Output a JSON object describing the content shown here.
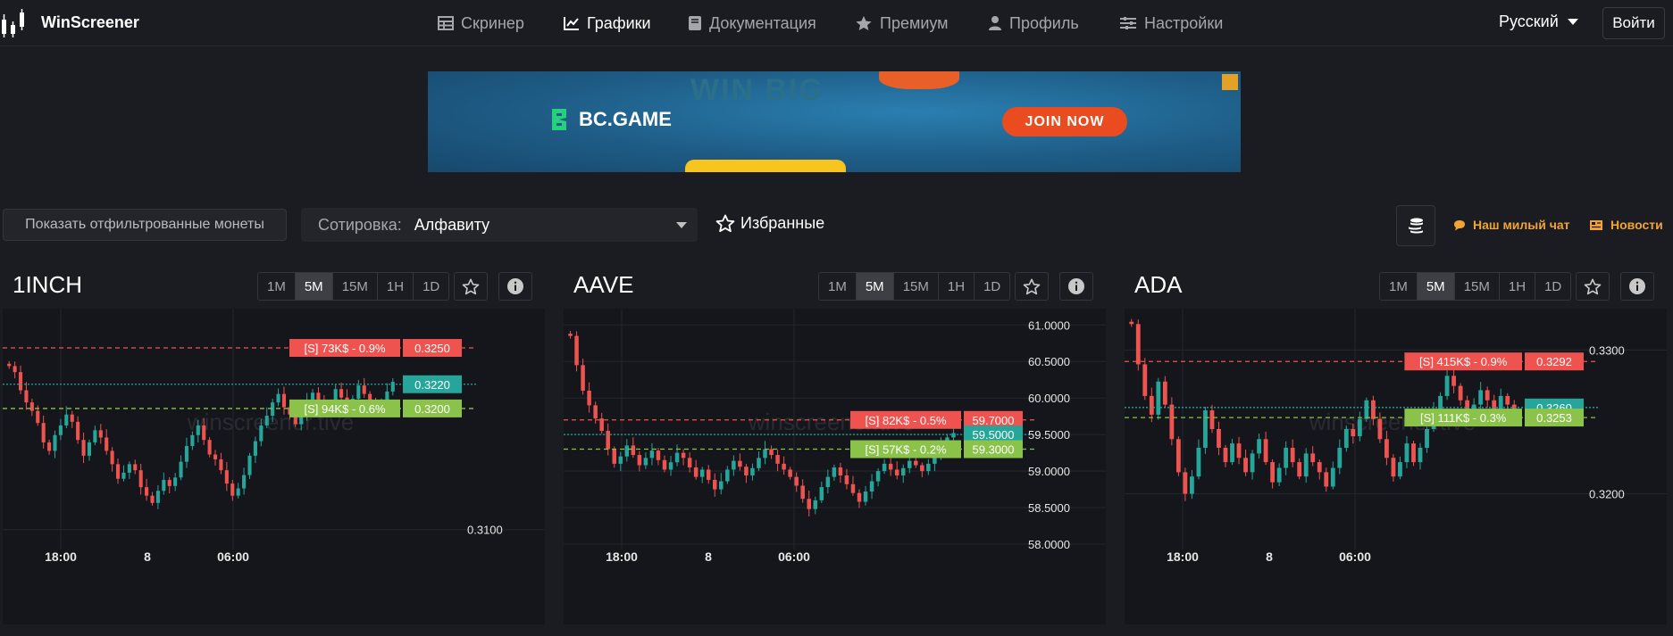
{
  "app": {
    "name": "WinScreener"
  },
  "nav": {
    "items": [
      {
        "label": "Скринер",
        "icon": "table-icon",
        "active": false
      },
      {
        "label": "Графики",
        "icon": "chart-line-icon",
        "active": true
      },
      {
        "label": "Документация",
        "icon": "book-icon",
        "active": false
      },
      {
        "label": "Премиум",
        "icon": "star-icon",
        "active": false
      },
      {
        "label": "Профиль",
        "icon": "user-icon",
        "active": false
      },
      {
        "label": "Настройки",
        "icon": "sliders-icon",
        "active": false
      }
    ],
    "language": "Русский",
    "login": "Войти"
  },
  "banner": {
    "brand": "BC.GAME",
    "cta": "JOIN NOW",
    "headline": "WIN BIG"
  },
  "controls": {
    "filter_button": "Показать отфильтрованные монеты",
    "sort_label": "Сотировка:",
    "sort_value": "Алфавиту",
    "favorites": "Избранные",
    "chat_link": "Наш милый чат",
    "news_link": "Новости"
  },
  "colors": {
    "bg": "#1b1c22",
    "chart_bg": "#15161b",
    "up": "#26a69a",
    "down": "#ef5350",
    "sell_level": "#ef5350",
    "buy_level": "#8bc34a",
    "current_price": "#26a69a",
    "accent": "#f1a433"
  },
  "timeframes": [
    "1M",
    "5M",
    "15M",
    "1H",
    "1D"
  ],
  "active_timeframe": "5M",
  "watermark": "winscreener.tive",
  "chart_data": [
    {
      "type": "candlestick",
      "symbol": "1INCH",
      "x_ticks": [
        "18:00",
        "8",
        "06:00"
      ],
      "y_ticks": [
        0.31
      ],
      "ylim": [
        0.3088,
        0.3278
      ],
      "levels": [
        {
          "kind": "sell",
          "label": "[S] 73K$ - 0.9%",
          "price": 0.325,
          "price_label": "0.3250"
        },
        {
          "kind": "current",
          "price": 0.322,
          "price_label": "0.3220"
        },
        {
          "kind": "buy",
          "label": "[S] 94K$ - 0.6%",
          "price": 0.32,
          "price_label": "0.3200"
        }
      ],
      "closes": [
        0.3235,
        0.323,
        0.3215,
        0.3205,
        0.3198,
        0.3188,
        0.3172,
        0.3165,
        0.3178,
        0.3186,
        0.3195,
        0.3189,
        0.3174,
        0.3161,
        0.3172,
        0.3182,
        0.3176,
        0.3165,
        0.3154,
        0.3142,
        0.3147,
        0.3154,
        0.3149,
        0.3135,
        0.3128,
        0.3122,
        0.3132,
        0.3141,
        0.3136,
        0.3143,
        0.3156,
        0.3169,
        0.3178,
        0.3186,
        0.3174,
        0.3162,
        0.3158,
        0.3149,
        0.3138,
        0.3128,
        0.3134,
        0.3145,
        0.3161,
        0.3173,
        0.3186,
        0.3194,
        0.3205,
        0.3212,
        0.3201,
        0.3195,
        0.3187,
        0.3193,
        0.3206,
        0.3213,
        0.3205,
        0.3198,
        0.3204,
        0.3216,
        0.3209,
        0.3202,
        0.3208,
        0.3219,
        0.3212,
        0.3205,
        0.3197,
        0.3203,
        0.3214,
        0.3222
      ]
    },
    {
      "type": "candlestick",
      "symbol": "AAVE",
      "x_ticks": [
        "18:00",
        "8",
        "06:00"
      ],
      "y_ticks": [
        61,
        60.5,
        60,
        59.5,
        59,
        58.5,
        58
      ],
      "y_tick_labels": [
        "61.0000",
        "60.5000",
        "60.0000",
        "59.5000",
        "59.0000",
        "58.5000",
        "58.0000"
      ],
      "ylim": [
        58,
        61.15
      ],
      "levels": [
        {
          "kind": "sell",
          "label": "[S] 82K$ - 0.5%",
          "price": 59.7,
          "price_label": "59.7000"
        },
        {
          "kind": "current",
          "price": 59.5,
          "price_label": "59.5000"
        },
        {
          "kind": "buy",
          "label": "[S] 57K$ - 0.2%",
          "price": 59.3,
          "price_label": "59.3000"
        }
      ],
      "closes": [
        60.85,
        60.45,
        60.1,
        59.9,
        59.72,
        59.55,
        59.3,
        59.1,
        59.2,
        59.35,
        59.22,
        59.08,
        59.18,
        59.28,
        59.15,
        59.02,
        59.12,
        59.25,
        59.18,
        59.05,
        58.92,
        59.02,
        58.88,
        58.75,
        58.86,
        59.02,
        59.14,
        59.06,
        58.94,
        59.04,
        59.18,
        59.3,
        59.22,
        59.1,
        59.02,
        58.92,
        58.8,
        58.62,
        58.48,
        58.6,
        58.78,
        58.92,
        59.05,
        58.94,
        58.82,
        58.7,
        58.58,
        58.72,
        58.86,
        59.0,
        59.1,
        59.02,
        58.94,
        59.04,
        59.14,
        59.08,
        59.0,
        59.1,
        59.22,
        59.35,
        59.46,
        59.52
      ]
    },
    {
      "type": "candlestick",
      "symbol": "ADA",
      "x_ticks": [
        "18:00",
        "8",
        "06:00"
      ],
      "y_ticks": [
        0.33,
        0.32
      ],
      "y_tick_labels": [
        "0.3300",
        "0.3200"
      ],
      "ylim": [
        0.3165,
        0.3325
      ],
      "levels": [
        {
          "kind": "sell",
          "label": "[S] 415K$ - 0.9%",
          "price": 0.3292,
          "price_label": "0.3292"
        },
        {
          "kind": "current",
          "price": 0.326,
          "price_label": "0.3260"
        },
        {
          "kind": "buy",
          "label": "[S] 111K$ - 0.3%",
          "price": 0.3253,
          "price_label": "0.3253"
        }
      ],
      "closes": [
        0.3318,
        0.329,
        0.3268,
        0.3255,
        0.3278,
        0.3262,
        0.3238,
        0.3215,
        0.32,
        0.3212,
        0.3232,
        0.3258,
        0.3245,
        0.3232,
        0.3222,
        0.3235,
        0.3225,
        0.3215,
        0.3228,
        0.3238,
        0.3222,
        0.3208,
        0.3218,
        0.3232,
        0.3222,
        0.3212,
        0.3228,
        0.3222,
        0.3215,
        0.3205,
        0.3218,
        0.3232,
        0.3245,
        0.324,
        0.3252,
        0.3265,
        0.3252,
        0.3238,
        0.3225,
        0.3212,
        0.3222,
        0.3235,
        0.3222,
        0.3232,
        0.3245,
        0.3258,
        0.3268,
        0.3282,
        0.3275,
        0.3265,
        0.3255,
        0.3262,
        0.3272,
        0.3265,
        0.3258,
        0.3268,
        0.3262,
        0.3258
      ]
    }
  ]
}
